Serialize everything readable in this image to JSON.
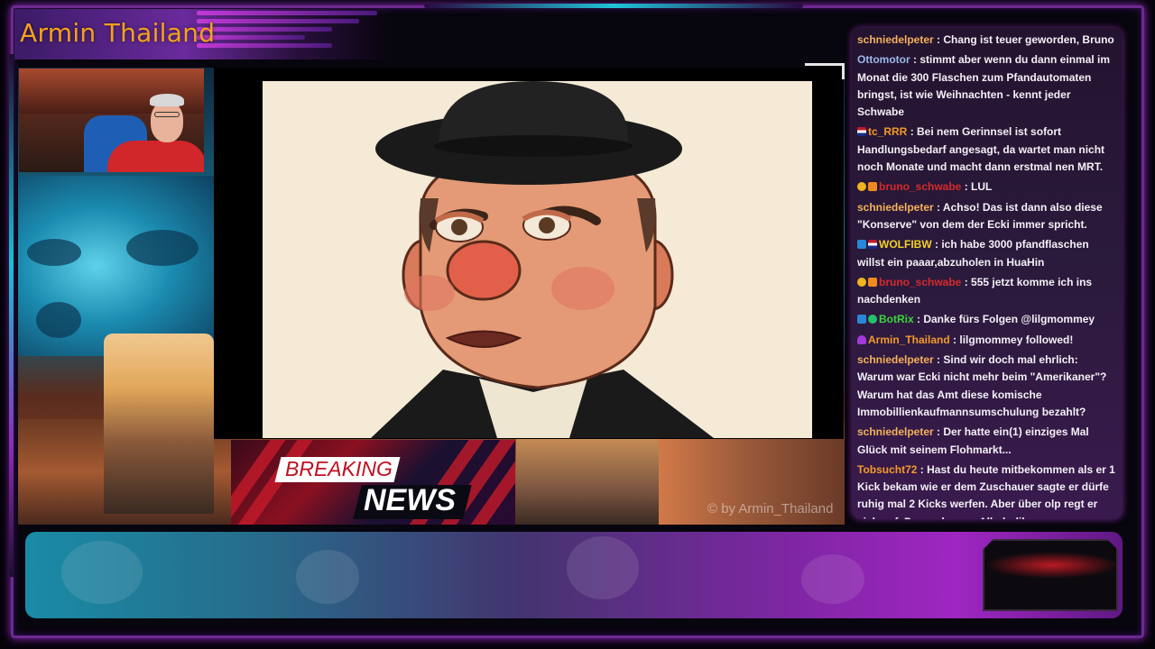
{
  "channel": {
    "title": "Armin Thailand"
  },
  "breaking": {
    "line1": "BREAKING",
    "line2": "NEWS"
  },
  "watermark": "© by Armin_Thailand",
  "colors": {
    "title": "#f4a21b",
    "frame": "#6b2a8f",
    "chat_bg": "#2b1a3c"
  },
  "chat": {
    "messages": [
      {
        "user": "schniedelpeter",
        "color": "#f3b15a",
        "badges": [],
        "text": ": Chang ist teuer geworden, Bruno"
      },
      {
        "user": "Ottomotor",
        "color": "#9ab8e8",
        "badges": [],
        "text": ": stimmt aber wenn du dann einmal im Monat die 300 Flaschen zum Pfandautomaten bringst, ist wie Weihnachten - kennt jeder Schwabe"
      },
      {
        "user": "tc_RRR",
        "color": "#f39a2a",
        "badges": [
          "flag"
        ],
        "text": ": Bei nem Gerinnsel ist sofort Handlungsbedarf angesagt, da wartet man nicht noch Monate und macht dann erstmal nen MRT."
      },
      {
        "user": "bruno_schwabe",
        "color": "#d42a2a",
        "badges": [
          "yellow",
          "orange"
        ],
        "text": ": LUL"
      },
      {
        "user": "schniedelpeter",
        "color": "#f3b15a",
        "badges": [],
        "text": ": Achso! Das ist dann also diese \"Konserve\" von dem der Ecki immer spricht."
      },
      {
        "user": "WOLFIBW",
        "color": "#f3d02a",
        "badges": [
          "blue",
          "flag"
        ],
        "text": ": ich habe 3000 pfandflaschen willst ein paaar,abzuholen in HuaHin"
      },
      {
        "user": "bruno_schwabe",
        "color": "#d42a2a",
        "badges": [
          "yellow",
          "orange"
        ],
        "text": ": 555 jetzt komme ich ins nachdenken"
      },
      {
        "user": "BotRix",
        "color": "#3ad63a",
        "badges": [
          "blue",
          "green"
        ],
        "text": ": Danke fürs Folgen @lilgmommey"
      },
      {
        "user": "Armin_Thailand",
        "color": "#f39a2a",
        "badges": [
          "purple"
        ],
        "text": ": lilgmommey followed!"
      },
      {
        "user": "schniedelpeter",
        "color": "#f3b15a",
        "badges": [],
        "text": ": Sind wir doch mal ehrlich: Warum war Ecki nicht mehr beim \"Amerikaner\"? Warum hat das Amt diese komische Immobillienkaufmannsumschulung bezahlt?"
      },
      {
        "user": "schniedelpeter",
        "color": "#f3b15a",
        "badges": [],
        "text": ": Der hatte ein(1) einziges Mal Glück mit seinem Flohmarkt..."
      },
      {
        "user": "Tobsucht72",
        "color": "#f39a2a",
        "badges": [],
        "text": ": Hast du heute mitbekommen als er 1 Kick bekam wie er dem Zuschauer sagte er dürfe ruhig mal 2 Kicks werfen. Aber über olp regt er sich auf. Der verlogene Alkoholiker"
      }
    ]
  }
}
